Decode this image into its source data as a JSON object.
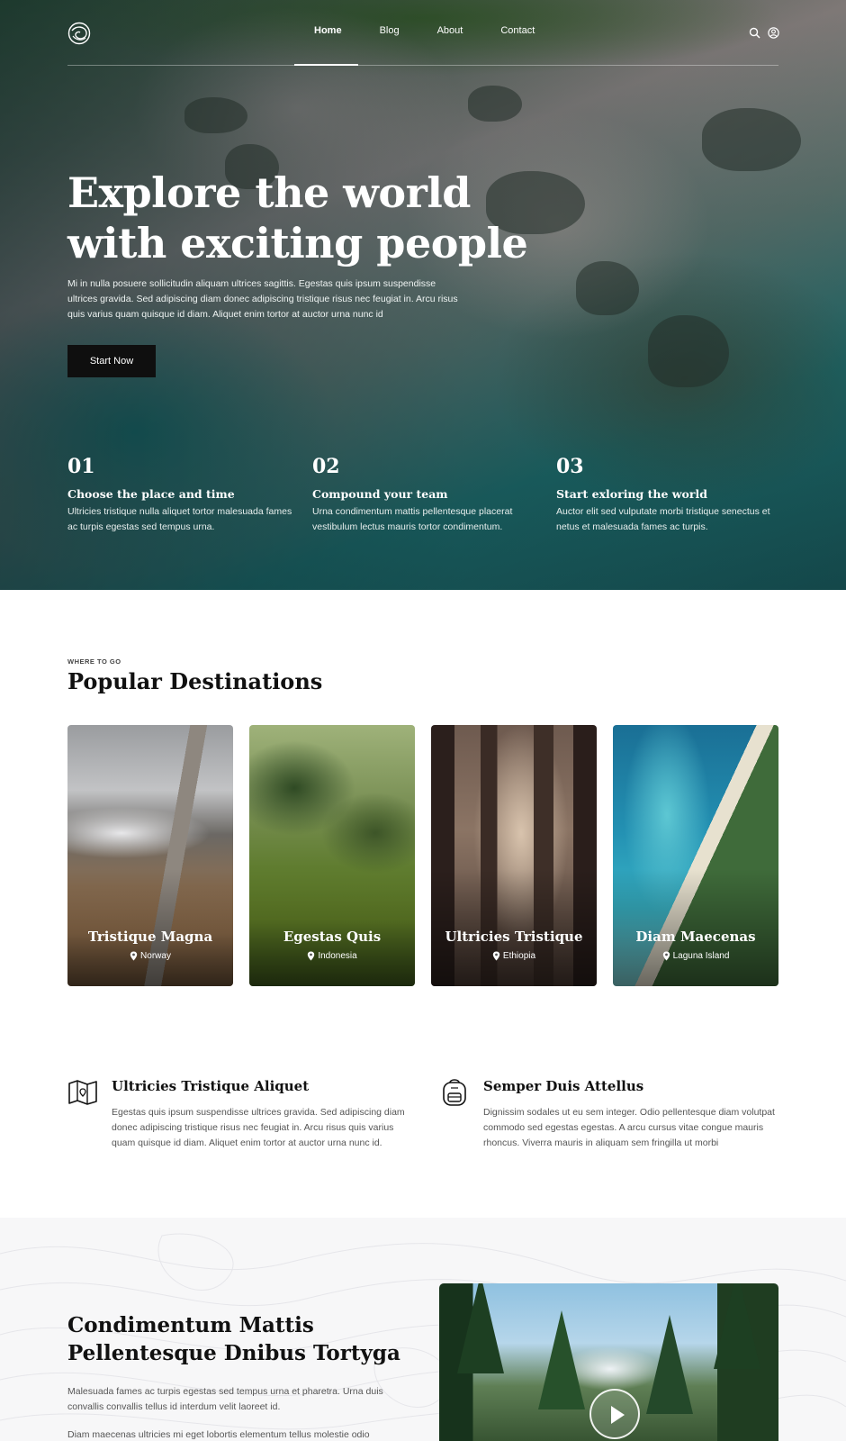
{
  "nav": {
    "links": [
      "Home",
      "Blog",
      "About",
      "Contact"
    ],
    "active": "Home"
  },
  "hero": {
    "title_line1": "Explore the world",
    "title_line2": "with exciting people",
    "description": "Mi in nulla posuere sollicitudin aliquam ultrices sagittis. Egestas quis ipsum suspendisse ultrices gravida. Sed adipiscing diam donec adipiscing tristique risus nec feugiat in. Arcu risus quis varius quam quisque id diam. Aliquet enim tortor at auctor urna nunc id",
    "cta": "Start Now"
  },
  "steps": [
    {
      "num": "01",
      "title": "Choose the place and time",
      "desc": "Ultricies tristique nulla aliquet tortor malesuada fames ac turpis egestas sed tempus urna."
    },
    {
      "num": "02",
      "title": "Compound your team",
      "desc": "Urna condimentum mattis pellentesque placerat vestibulum lectus mauris tortor condimentum."
    },
    {
      "num": "03",
      "title": "Start exloring the world",
      "desc": "Auctor elit sed vulputate morbi tristique senectus et netus et malesuada fames ac turpis."
    }
  ],
  "destinations": {
    "eyebrow": "WHERE TO GO",
    "title": "Popular Destinations",
    "cards": [
      {
        "name": "Tristique Magna",
        "location": "Norway"
      },
      {
        "name": "Egestas Quis",
        "location": "Indonesia"
      },
      {
        "name": "Ultricies Tristique",
        "location": "Ethiopia"
      },
      {
        "name": "Diam Maecenas",
        "location": "Laguna Island"
      }
    ]
  },
  "features": [
    {
      "icon": "map-icon",
      "title": "Ultricies Tristique Aliquet",
      "desc": "Egestas quis ipsum suspendisse ultrices gravida. Sed adipiscing diam donec adipiscing tristique risus nec feugiat in. Arcu risus quis varius quam quisque id diam. Aliquet enim tortor at auctor urna nunc id."
    },
    {
      "icon": "backpack-icon",
      "title": "Semper Duis Attellus",
      "desc": "Dignissim sodales ut eu sem integer. Odio pellentesque diam volutpat commodo sed egestas egestas. A arcu cursus vitae congue mauris rhoncus. Viverra mauris in aliquam sem fringilla ut morbi"
    }
  ],
  "story": {
    "title_line1": "Condimentum Mattis",
    "title_line2": "Pellentesque Dnibus Tortyga",
    "p1": "Malesuada fames ac turpis egestas sed tempus urna et pharetra. Urna duis convallis convallis tellus id interdum velit laoreet id.",
    "p2": "Diam maecenas ultricies mi eget lobortis elementum tellus molestie odio"
  },
  "colors": {
    "dark_button": "#0f0f0f",
    "text_dark": "#111111",
    "text_muted": "#555555",
    "section_bg": "#f7f7f8"
  }
}
